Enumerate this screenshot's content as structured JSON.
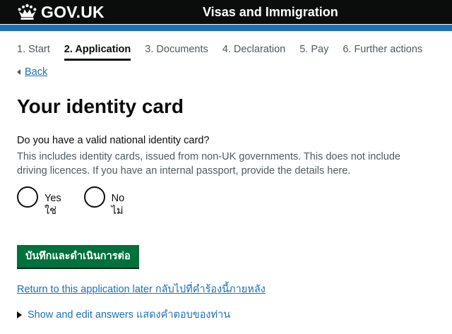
{
  "header": {
    "logo_text": "GOV.UK",
    "service_name": "Visas and Immigration"
  },
  "steps": [
    {
      "label": "1. Start"
    },
    {
      "label": "2. Application",
      "current": true
    },
    {
      "label": "3. Documents"
    },
    {
      "label": "4. Declaration"
    },
    {
      "label": "5. Pay"
    },
    {
      "label": "6. Further actions"
    }
  ],
  "back_link": "Back",
  "page_title": "Your identity card",
  "question": {
    "label": "Do you have a valid national identity card?",
    "hint": "This includes identity cards, issued from non-UK governments. This does not include driving licences. If you have an internal passport, provide the details here.",
    "options": [
      {
        "label": "Yes",
        "sublabel": "ใช่"
      },
      {
        "label": "No",
        "sublabel": "ไม่"
      }
    ]
  },
  "continue_button": "บันทึกและดำเนินการต่อ",
  "return_link": "Return to this application later กลับไปที่คำร้องนี้ภายหลัง",
  "details_summary": "Show and edit answers แสดงคำตอบของท่าน",
  "colors": {
    "header_bg": "#0b0c0c",
    "brand_blue": "#1d70b8",
    "button_green": "#00703c",
    "link": "#1d70b8",
    "hint_grey": "#505a5f"
  },
  "icons": {
    "logo": "crown-icon",
    "back": "back-arrow-icon",
    "details": "triangle-right-icon"
  }
}
